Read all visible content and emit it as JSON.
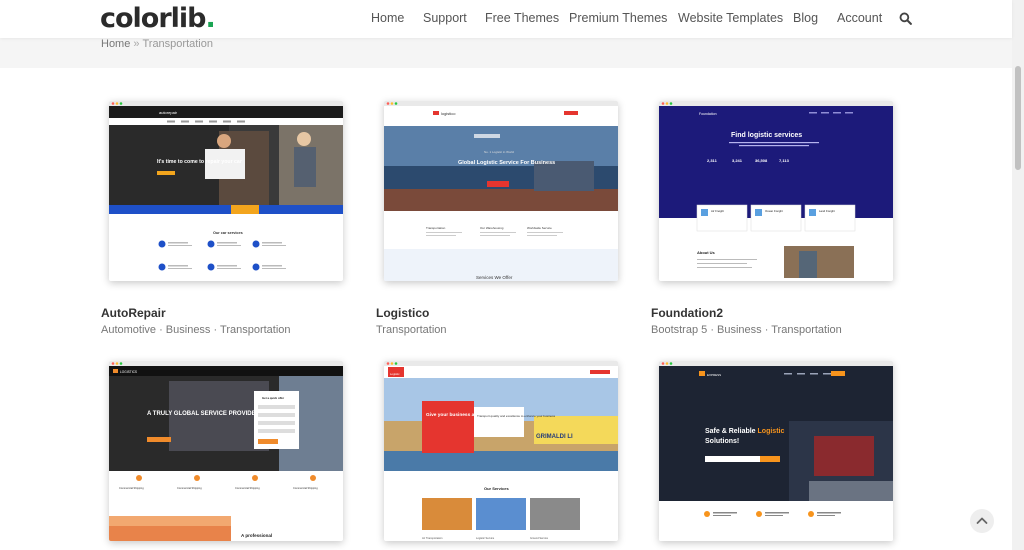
{
  "header": {
    "logo_text": "colorlib",
    "logo_dot": ".",
    "nav": [
      "Home",
      "Support",
      "Free Themes",
      "Premium Themes",
      "Website Templates",
      "Blog",
      "Account"
    ]
  },
  "breadcrumb": {
    "home": "Home",
    "separator": "»",
    "current": "Transportation"
  },
  "cards": [
    {
      "title": "AutoRepair",
      "tags": "Automotive · Business · Transportation",
      "preview": {
        "brand": "autorepair",
        "headline": "It's time to come to repair your car",
        "section": "Our car services",
        "accent": "#f3a51d",
        "band": "#1e50c8"
      }
    },
    {
      "title": "Logistico",
      "tags": "Transportation",
      "preview": {
        "brand": "logistico",
        "tagline": "No. 1 Logistic in World",
        "headline": "Global Logistic Service For Business",
        "section": "Services We Offer",
        "features": [
          "Transportation",
          "Our Warehousing",
          "Worldwide Service"
        ],
        "accent": "#e5352f"
      }
    },
    {
      "title": "Foundation2",
      "tags": "Bootstrap 5 · Business · Transportation",
      "preview": {
        "brand": "Foundation",
        "headline": "Find logistic services",
        "stats": [
          "2,311",
          "3,241",
          "36,508",
          "7,113"
        ],
        "boxes": [
          "Air Freight",
          "Ocean Freight",
          "Land Freight"
        ],
        "section": "About Us",
        "accent": "#1c1a7a"
      }
    },
    {
      "title": "",
      "tags": "",
      "preview": {
        "brand": "LOGISTICS",
        "headline": "A TRULY GLOBAL SERVICE PROVIDER",
        "form_title": "Get a quick offer",
        "features": [
          "Commercial Shipping",
          "Commercial Shipping",
          "Commercial Shipping",
          "Commercial Shipping"
        ],
        "bottom": "A professional",
        "accent": "#f08b2b"
      }
    },
    {
      "title": "",
      "tags": "",
      "preview": {
        "brand": "Logistic",
        "headline": "Give your business a flow",
        "body": "Transport quality and excellence to enhance your business",
        "ship": "GRIMALDI LI",
        "section": "Our Services",
        "services": [
          "Air Transportation",
          "Logistic Service",
          "Ground Service"
        ],
        "accent": "#e5352f"
      }
    },
    {
      "title": "",
      "tags": "",
      "preview": {
        "brand": "EXPRESS",
        "headline": "Safe & Reliable",
        "headline_accent": "Logistic",
        "headline_end": "Solutions!",
        "accent": "#f7941d"
      }
    }
  ]
}
